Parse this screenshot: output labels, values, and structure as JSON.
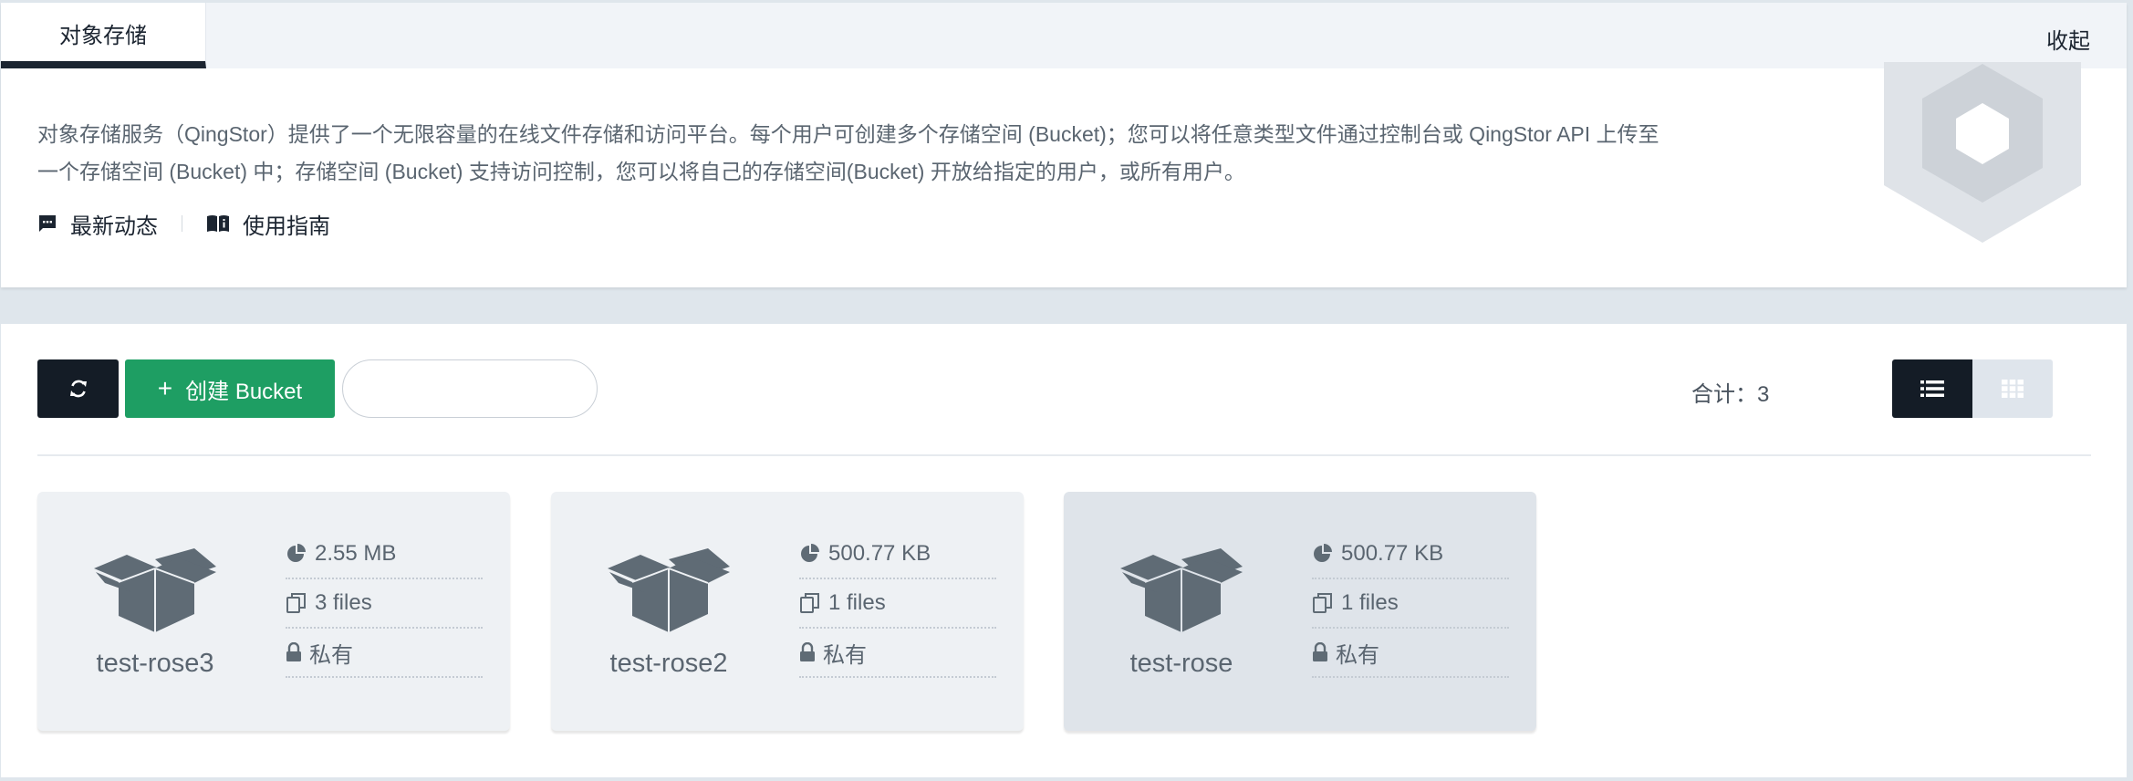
{
  "header": {
    "tab_label": "对象存储",
    "collapse_label": "收起"
  },
  "intro": {
    "description_line1": "对象存储服务（QingStor）提供了一个无限容量的在线文件存储和访问平台。每个用户可创建多个存储空间 (Bucket)；您可以将任意类型文件通过控制台或 QingStor API 上传至",
    "description_line2": "一个存储空间 (Bucket) 中；存储空间 (Bucket) 支持访问控制，您可以将自己的存储空间(Bucket) 开放给指定的用户，或所有用户。",
    "links": [
      {
        "label": "最新动态",
        "icon": "chat-icon"
      },
      {
        "label": "使用指南",
        "icon": "book-icon"
      }
    ]
  },
  "toolbar": {
    "refresh_icon": "refresh-icon",
    "create_plus": "+",
    "create_label": "创建 Bucket",
    "search_value": "",
    "search_placeholder": "",
    "total_label": "合计：3",
    "view_modes": [
      "list-icon",
      "grid-icon"
    ],
    "active_view": "list"
  },
  "buckets": [
    {
      "name": "test-rose3",
      "size": "2.55 MB",
      "files": "3 files",
      "access": "私有",
      "selected": false
    },
    {
      "name": "test-rose2",
      "size": "500.77 KB",
      "files": "1 files",
      "access": "私有",
      "selected": false
    },
    {
      "name": "test-rose",
      "size": "500.77 KB",
      "files": "1 files",
      "access": "私有",
      "selected": true
    }
  ],
  "colors": {
    "primary_dark": "#141c26",
    "create_green": "#1e9e63",
    "card_bg": "#eef1f4",
    "card_selected_bg": "#dfe4ea",
    "icon_gray": "#5f6b75"
  }
}
